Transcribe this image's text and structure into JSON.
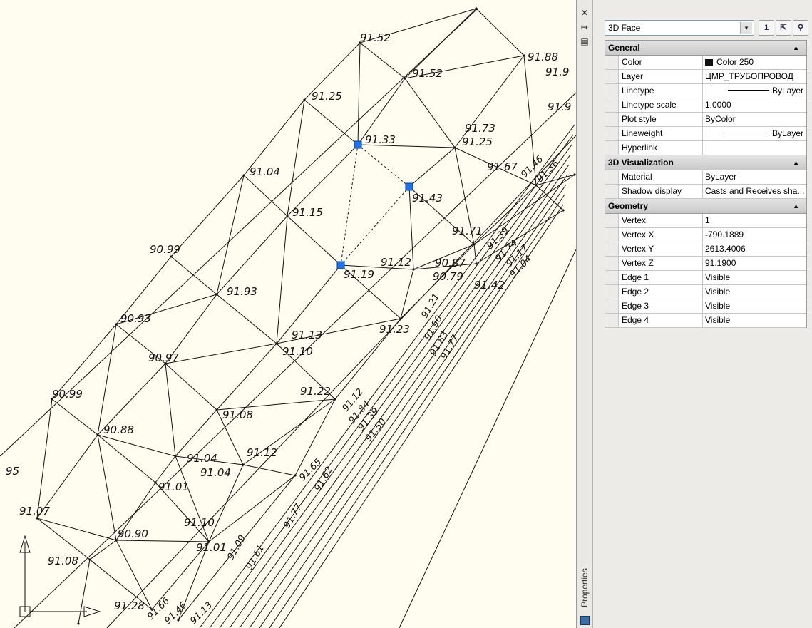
{
  "drawing": {
    "elevation_labels": [
      "91.52",
      "91.52",
      "91.88",
      "91.9",
      "91.25",
      "91.9",
      "91.73",
      "91.25",
      "91.33",
      "91.67",
      "91.04",
      "91.43",
      "91.15",
      "91.71",
      "90.99",
      "91.12",
      "90.87",
      "91.19",
      "90.79",
      "91.42",
      "91.39",
      "91.74",
      "91.04",
      "91.93",
      "91.21",
      "91.23",
      "90.93",
      "91.13",
      "91.10",
      "91.90",
      "90.97",
      "91.22",
      "91.12",
      "90.99",
      "91.08",
      "90.88",
      "91.12",
      "91.04",
      "91.04",
      "95",
      "91.01",
      "91.65",
      "91.07",
      "91.10",
      "90.90",
      "91.01",
      "91.09",
      "91.08",
      "91.28",
      "91.66",
      "91.46",
      "91.13",
      "91.46",
      "91.36",
      "91.62",
      "91.77",
      "91.61",
      "91.17",
      "91.83",
      "91.77",
      "91.84",
      "91.50",
      "91.39"
    ],
    "selected_vertices": [
      "91.33",
      "91.43",
      "91.19"
    ]
  },
  "gutter": {
    "close_glyph": "✕",
    "autohide_glyph": "↦",
    "menu_glyph": "▤",
    "vertical_title": "Properties"
  },
  "panel": {
    "object_type": "3D Face",
    "dropdown_glyph": "▾",
    "buttons": {
      "pickadd_glyph": "1",
      "select_glyph": "⇱",
      "quickselect_glyph": "⚲"
    },
    "sections": [
      {
        "title": "General",
        "collapse_glyph": "▲",
        "rows": [
          {
            "name": "Color",
            "value": "Color 250",
            "swatch": "#101010"
          },
          {
            "name": "Layer",
            "value": "ЦМР_ТРУБОПРОВОД"
          },
          {
            "name": "Linetype",
            "value": "ByLayer"
          },
          {
            "name": "Linetype scale",
            "value": "1.0000"
          },
          {
            "name": "Plot style",
            "value": "ByColor"
          },
          {
            "name": "Lineweight",
            "value": "ByLayer"
          },
          {
            "name": "Hyperlink",
            "value": ""
          }
        ]
      },
      {
        "title": "3D Visualization",
        "collapse_glyph": "▲",
        "rows": [
          {
            "name": "Material",
            "value": "ByLayer"
          },
          {
            "name": "Shadow display",
            "value": "Casts and Receives sha..."
          }
        ]
      },
      {
        "title": "Geometry",
        "collapse_glyph": "▲",
        "rows": [
          {
            "name": "Vertex",
            "value": "1"
          },
          {
            "name": "Vertex X",
            "value": "-790.1889"
          },
          {
            "name": "Vertex Y",
            "value": "2613.4006"
          },
          {
            "name": "Vertex Z",
            "value": "91.1900"
          },
          {
            "name": "Edge 1",
            "value": "Visible"
          },
          {
            "name": "Edge 2",
            "value": "Visible"
          },
          {
            "name": "Edge 3",
            "value": "Visible"
          },
          {
            "name": "Edge 4",
            "value": "Visible"
          }
        ]
      }
    ]
  },
  "colors": {
    "canvas": "#fffcf0",
    "grip": "#1e73e8",
    "line": "#111111"
  }
}
